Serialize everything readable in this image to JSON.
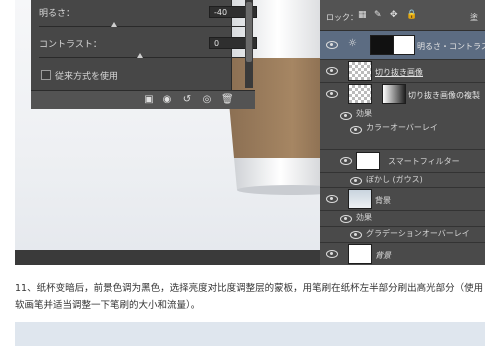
{
  "properties_panel": {
    "brightness_label": "明るさ：",
    "brightness_value": "-40",
    "contrast_label": "コントラスト：",
    "contrast_value": "0",
    "legacy_label": "従来方式を使用"
  },
  "layers_panel": {
    "lock_label": "ロック：",
    "fill_label": "塗",
    "layers": [
      {
        "name": "明るさ・コントラス"
      },
      {
        "name": "切り抜き画像"
      },
      {
        "name": "切り抜き画像の複製"
      },
      {
        "name": "背景"
      },
      {
        "name": "背景"
      }
    ],
    "effects_label": "効果",
    "color_overlay": "カラーオーバーレイ",
    "smart_filter": "スマートフィルター",
    "gaussian_blur": "ぼかし (ガウス)",
    "gradient_overlay": "グラデーションオーバーレイ"
  },
  "caption": "11、纸杯变暗后，前景色调为黑色，选择亮度对比度调整层的蒙板，用笔刷在纸杯左半部分刷出高光部分（使用软画笔并适当调整一下笔刷的大小和流量）。"
}
